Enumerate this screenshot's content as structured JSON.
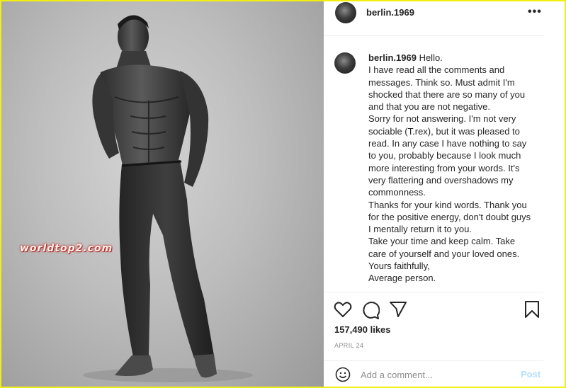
{
  "photo": {
    "watermark": "worldtop2.com"
  },
  "header": {
    "username": "berlin.1969",
    "more_label": "•••"
  },
  "caption": {
    "username": "berlin.1969",
    "lines": [
      "Hello.",
      "I have read all the comments and messages. Think so. Must admit I'm shocked that there are so many of you and that you are not negative.",
      "Sorry for not answering. I'm not very sociable (T.rex), but it was pleased to read. In any case I have nothing to say to you, probably because I look much more interesting from your words. It's very flattering and overshadows my commonness.",
      "Thanks for your kind words. Thank you for the positive energy, don't doubt guys I mentally return it to you.",
      "Take your time and keep calm. Take care of yourself and your loved ones.",
      "Yours faithfully,",
      "Average person."
    ]
  },
  "actions": {
    "like_icon": "heart-icon",
    "comment_icon": "comment-bubble-icon",
    "share_icon": "paper-plane-icon",
    "save_icon": "bookmark-icon"
  },
  "likes": "157,490 likes",
  "date": "APRIL 24",
  "comment": {
    "placeholder": "Add a comment...",
    "post_label": "Post",
    "emoji_icon": "smiley-icon"
  },
  "colors": {
    "border": "#f2ee12",
    "post": "#b2dffc",
    "text": "#262626",
    "muted": "#8e8e8e"
  }
}
